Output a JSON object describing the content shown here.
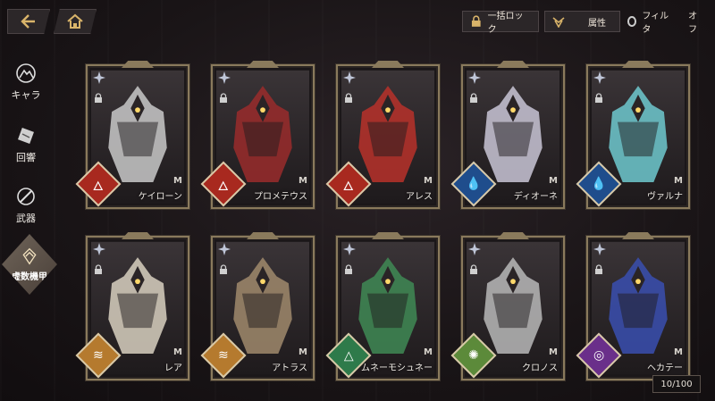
{
  "nav": {
    "back_icon": "back-arrow-icon",
    "home_icon": "home-icon"
  },
  "toolbar": {
    "bulk_lock_label": "一括ロック",
    "attribute_label": "属性",
    "filter_label": "フィルタ",
    "filter_state": "オフ"
  },
  "side_tabs": [
    {
      "label": "キャラ",
      "icon": "character-icon"
    },
    {
      "label": "回響",
      "icon": "echo-icon"
    },
    {
      "label": "武器",
      "icon": "weapon-icon"
    },
    {
      "label": "虚数機甲",
      "icon": "mech-icon",
      "selected": true
    }
  ],
  "cards": [
    {
      "name": "ケイローン",
      "element": "fire",
      "brand": "M",
      "accent": "#c9c9c9"
    },
    {
      "name": "プロメテウス",
      "element": "fire",
      "brand": "M",
      "accent": "#9a2b2b"
    },
    {
      "name": "アレス",
      "element": "fire",
      "brand": "M",
      "accent": "#b8312a"
    },
    {
      "name": "ディオーネ",
      "element": "water",
      "brand": "M",
      "accent": "#c9c6d6"
    },
    {
      "name": "ヴァルナ",
      "element": "water",
      "brand": "M",
      "accent": "#6fc9cf"
    },
    {
      "name": "レア",
      "element": "earth",
      "brand": "M",
      "accent": "#d8d0c0"
    },
    {
      "name": "アトラス",
      "element": "earth",
      "brand": "M",
      "accent": "#a08a6c"
    },
    {
      "name": "ムネーモシュネー",
      "element": "wind",
      "brand": "M",
      "accent": "#3f8a55"
    },
    {
      "name": "クロノス",
      "element": "light",
      "brand": "M",
      "accent": "#b8b8b8"
    },
    {
      "name": "ヘカテー",
      "element": "dark",
      "brand": "M",
      "accent": "#3a4fb0"
    }
  ],
  "counter": "10/100"
}
